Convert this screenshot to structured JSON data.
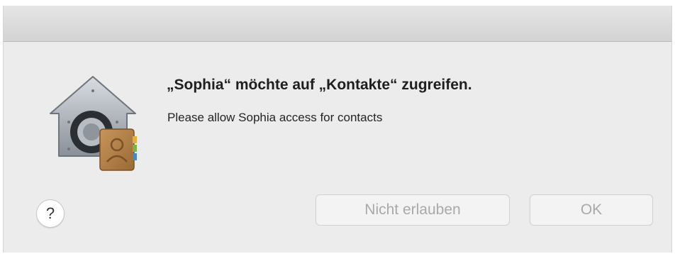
{
  "dialog": {
    "headline": "„Sophia“ möchte auf „Kontakte“ zugreifen.",
    "message": "Please allow Sophia access for contacts",
    "icon": "contacts-privacy-lock-icon",
    "help_label": "?",
    "buttons": {
      "deny_label": "Nicht erlauben",
      "ok_label": "OK"
    }
  }
}
